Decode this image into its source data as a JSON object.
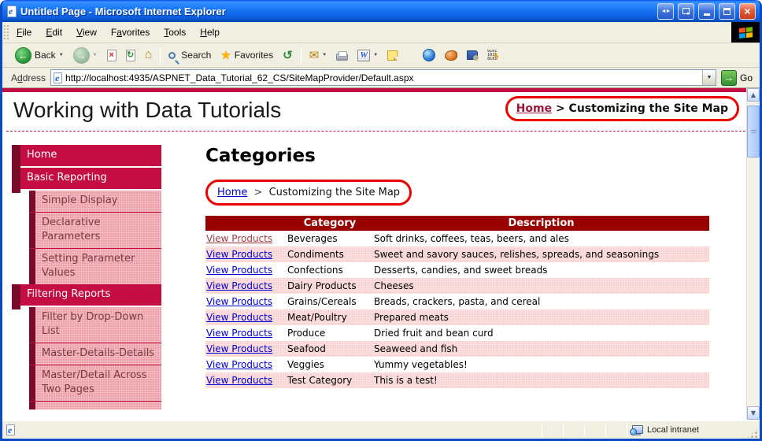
{
  "window": {
    "title": "Untitled Page - Microsoft Internet Explorer"
  },
  "menu": {
    "items": [
      {
        "label": "File",
        "accel": 0
      },
      {
        "label": "Edit",
        "accel": 0
      },
      {
        "label": "View",
        "accel": 0
      },
      {
        "label": "Favorites",
        "accel": 1
      },
      {
        "label": "Tools",
        "accel": 0
      },
      {
        "label": "Help",
        "accel": 0
      }
    ]
  },
  "toolbar": {
    "back_label": "Back",
    "search_label": "Search",
    "favorites_label": "Favorites"
  },
  "address": {
    "label": "Address",
    "accel": 1,
    "url": "http://localhost:4935/ASPNET_Data_Tutorial_62_CS/SiteMapProvider/Default.aspx",
    "go_label": "Go"
  },
  "page": {
    "site_title": "Working with Data Tutorials",
    "header_breadcrumb": {
      "home": "Home",
      "separator": ">",
      "current": "Customizing the Site Map"
    },
    "heading": "Categories",
    "content_breadcrumb": {
      "home": "Home",
      "separator": ">",
      "current": "Customizing the Site Map"
    },
    "sidebar": [
      {
        "label": "Home",
        "level": 1
      },
      {
        "label": "Basic Reporting",
        "level": 1
      },
      {
        "label": "Simple Display",
        "level": 2
      },
      {
        "label": "Declarative Parameters",
        "level": 2
      },
      {
        "label": "Setting Parameter Values",
        "level": 2
      },
      {
        "label": "Filtering Reports",
        "level": 1
      },
      {
        "label": "Filter by Drop-Down List",
        "level": 2
      },
      {
        "label": "Master-Details-Details",
        "level": 2
      },
      {
        "label": "Master/Detail Across Two Pages",
        "level": 2
      }
    ],
    "table": {
      "headers": [
        "",
        "Category",
        "Description"
      ],
      "link_label": "View Products",
      "rows": [
        {
          "category": "Beverages",
          "description": "Soft drinks, coffees, teas, beers, and ales",
          "visited": true
        },
        {
          "category": "Condiments",
          "description": "Sweet and savory sauces, relishes, spreads, and seasonings"
        },
        {
          "category": "Confections",
          "description": "Desserts, candies, and sweet breads"
        },
        {
          "category": "Dairy Products",
          "description": "Cheeses"
        },
        {
          "category": "Grains/Cereals",
          "description": "Breads, crackers, pasta, and cereal"
        },
        {
          "category": "Meat/Poultry",
          "description": "Prepared meats"
        },
        {
          "category": "Produce",
          "description": "Dried fruit and bean curd"
        },
        {
          "category": "Seafood",
          "description": "Seaweed and fish"
        },
        {
          "category": "Veggies",
          "description": "Yummy vegetables!"
        },
        {
          "category": "Test Category",
          "description": "This is a test!"
        }
      ]
    }
  },
  "statusbar": {
    "zone_label": "Local intranet"
  },
  "colors": {
    "crimson": "#C40D42",
    "maroon": "#7B0A2B",
    "table_header": "#990000",
    "row_pink": "#F8D2D2",
    "side_pink": "#ED9FA8",
    "side_text": "#7B3840",
    "link_blue": "#0000D4",
    "link_visited": "#9E3A44",
    "annotation": "#EE0000"
  }
}
